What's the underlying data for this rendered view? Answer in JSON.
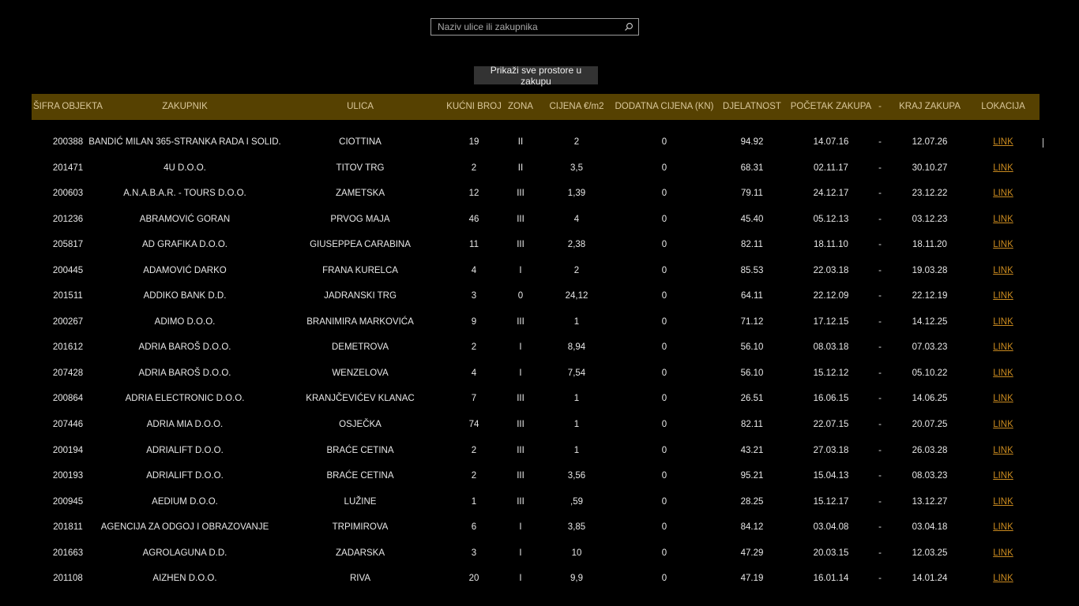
{
  "search": {
    "placeholder": "Naziv ulice ili zakupnika",
    "value": ""
  },
  "show_all_label": "Prikaži sve prostore u zakupu",
  "columns": [
    "ŠIFRA OBJEKTA",
    "ZAKUPNIK",
    "ULICA",
    "KUĆNI BROJ",
    "ZONA",
    "CIJENA €/m2",
    "DODATNA CIJENA (KN)",
    "DJELATNOST",
    "POČETAK ZAKUPA",
    "-",
    "KRAJ ZAKUPA",
    "LOKACIJA"
  ],
  "rows": [
    [
      "200388",
      "BANDIĆ MILAN 365-STRANKA RADA I SOLID.",
      "CIOTTINA",
      "19",
      "II",
      "2",
      "0",
      "94.92",
      "14.07.16",
      "-",
      "12.07.26",
      "LINK"
    ],
    [
      "201471",
      "4U D.O.O.",
      "TITOV TRG",
      "2",
      "II",
      "3,5",
      "0",
      "68.31",
      "02.11.17",
      "-",
      "30.10.27",
      "LINK"
    ],
    [
      "200603",
      "A.N.A.B.A.R. - TOURS D.O.O.",
      "ZAMETSKA",
      "12",
      "III",
      "1,39",
      "0",
      "79.11",
      "24.12.17",
      "-",
      "23.12.22",
      "LINK"
    ],
    [
      "201236",
      "ABRAMOVIĆ GORAN",
      "PRVOG MAJA",
      "46",
      "III",
      "4",
      "0",
      "45.40",
      "05.12.13",
      "-",
      "03.12.23",
      "LINK"
    ],
    [
      "205817",
      "AD GRAFIKA D.O.O.",
      "GIUSEPPEA CARABINA",
      "11",
      "III",
      "2,38",
      "0",
      "82.11",
      "18.11.10",
      "-",
      "18.11.20",
      "LINK"
    ],
    [
      "200445",
      "ADAMOVIĆ DARKO",
      "FRANA KURELCA",
      "4",
      "I",
      "2",
      "0",
      "85.53",
      "22.03.18",
      "-",
      "19.03.28",
      "LINK"
    ],
    [
      "201511",
      "ADDIKO BANK D.D.",
      "JADRANSKI TRG",
      "3",
      "0",
      "24,12",
      "0",
      "64.11",
      "22.12.09",
      "-",
      "22.12.19",
      "LINK"
    ],
    [
      "200267",
      "ADIMO D.O.O.",
      "BRANIMIRA MARKOVIĆA",
      "9",
      "III",
      "1",
      "0",
      "71.12",
      "17.12.15",
      "-",
      "14.12.25",
      "LINK"
    ],
    [
      "201612",
      "ADRIA BAROŠ D.O.O.",
      "DEMETROVA",
      "2",
      "I",
      "8,94",
      "0",
      "56.10",
      "08.03.18",
      "-",
      "07.03.23",
      "LINK"
    ],
    [
      "207428",
      "ADRIA BAROŠ D.O.O.",
      "WENZELOVA",
      "4",
      "I",
      "7,54",
      "0",
      "56.10",
      "15.12.12",
      "-",
      "05.10.22",
      "LINK"
    ],
    [
      "200864",
      "ADRIA ELECTRONIC D.O.O.",
      "KRANJČEVIĆEV KLANAC",
      "7",
      "III",
      "1",
      "0",
      "26.51",
      "16.06.15",
      "-",
      "14.06.25",
      "LINK"
    ],
    [
      "207446",
      "ADRIA MIA D.O.O.",
      "OSJEČKA",
      "74",
      "III",
      "1",
      "0",
      "82.11",
      "22.07.15",
      "-",
      "20.07.25",
      "LINK"
    ],
    [
      "200194",
      "ADRIALIFT D.O.O.",
      "BRAĆE CETINA",
      "2",
      "III",
      "1",
      "0",
      "43.21",
      "27.03.18",
      "-",
      "26.03.28",
      "LINK"
    ],
    [
      "200193",
      "ADRIALIFT D.O.O.",
      "BRAĆE CETINA",
      "2",
      "III",
      "3,56",
      "0",
      "95.21",
      "15.04.13",
      "-",
      "08.03.23",
      "LINK"
    ],
    [
      "200945",
      "AEDIUM D.O.O.",
      "LUŽINE",
      "1",
      "III",
      ",59",
      "0",
      "28.25",
      "15.12.17",
      "-",
      "13.12.27",
      "LINK"
    ],
    [
      "201811",
      "AGENCIJA ZA ODGOJ I OBRAZOVANJE",
      "TRPIMIROVA",
      "6",
      "I",
      "3,85",
      "0",
      "84.12",
      "03.04.08",
      "-",
      "03.04.18",
      "LINK"
    ],
    [
      "201663",
      "AGROLAGUNA D.D.",
      "ZADARSKA",
      "3",
      "I",
      "10",
      "0",
      "47.29",
      "20.03.15",
      "-",
      "12.03.25",
      "LINK"
    ],
    [
      "201108",
      "AIZHEN D.O.O.",
      "RIVA",
      "20",
      "I",
      "9,9",
      "0",
      "47.19",
      "16.01.14",
      "-",
      "14.01.24",
      "LINK"
    ]
  ],
  "colors": {
    "background": "#000000",
    "header_bg": "#564101",
    "header_text": "#d9c79a",
    "link": "#c98a1f",
    "button_bg": "#333333"
  }
}
